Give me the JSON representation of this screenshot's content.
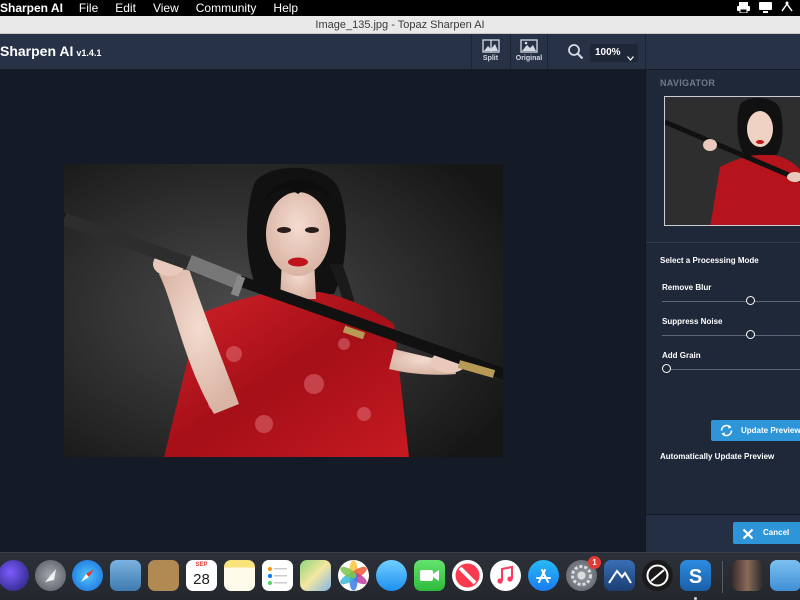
{
  "menubar": {
    "app_name": "Sharpen AI",
    "items": [
      "File",
      "Edit",
      "View",
      "Community",
      "Help"
    ]
  },
  "window": {
    "title": "Image_135.jpg - Topaz Sharpen AI"
  },
  "toolbar": {
    "brand": "Sharpen AI",
    "version": "v1.4.1",
    "split_label": "Split",
    "original_label": "Original",
    "zoom_value": "100%"
  },
  "panel": {
    "navigator_label": "NAVIGATOR",
    "mode_title": "Select a Processing Mode",
    "sliders": [
      {
        "label": "Remove Blur",
        "value": 0.6
      },
      {
        "label": "Suppress Noise",
        "value": 0.6
      },
      {
        "label": "Add Grain",
        "value": 0.0
      }
    ],
    "update_label": "Update Preview",
    "auto_update_label": "Automatically Update Preview",
    "cancel_label": "Cancel"
  },
  "dock": {
    "calendar_month": "SEP",
    "calendar_day": "28",
    "prefs_badge": "1",
    "apps": [
      "siri",
      "launchpad",
      "safari",
      "mail-eagle",
      "contacts",
      "calendar",
      "notes",
      "reminders",
      "maps",
      "photos",
      "messages",
      "facetime",
      "news",
      "music",
      "app-store",
      "system-preferences",
      "topaz-adjust",
      "topaz-studio",
      "topaz-sharpen",
      "photo-stack",
      "downloads-folder"
    ]
  },
  "colors": {
    "toolbar_bg": "#273246",
    "panel_bg": "#1f2839",
    "canvas_bg": "#141a26",
    "accent": "#2f95d9"
  }
}
